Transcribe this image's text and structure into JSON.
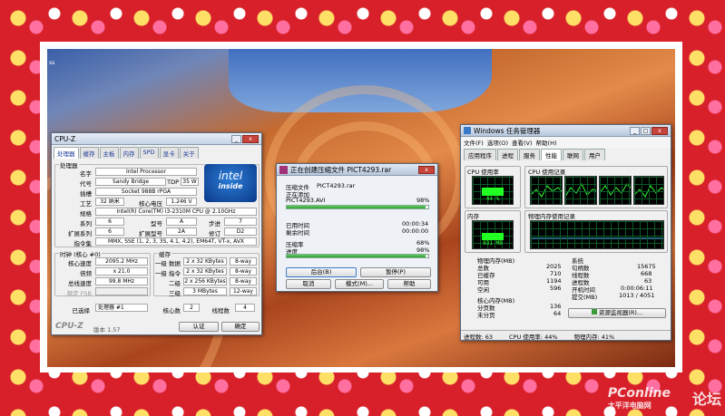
{
  "desktop": {
    "corner_text": "ss"
  },
  "cpuz": {
    "title": "CPU-Z",
    "tabs": [
      "处理器",
      "缓存",
      "主板",
      "内存",
      "SPD",
      "显卡",
      "关于"
    ],
    "group_processor": "处理器",
    "name_label": "名字",
    "name_value": "Intel Processor",
    "codename_label": "代号",
    "codename_value": "Sandy Bridge",
    "tdp_label": "TDP",
    "tdp_value": "35 W",
    "socket_label": "插槽",
    "socket_value": "Socket 988B rPGA",
    "tech_label": "工艺",
    "tech_value": "32 纳米",
    "voltage_label": "核心电压",
    "voltage_value": "1.246 V",
    "spec_label": "规格",
    "spec_value": "Intel(R) Core(TM) i3-2310M CPU @ 2.10GHz",
    "family_label": "系列",
    "family_value": "6",
    "model_label": "型号",
    "model_value": "A",
    "stepping_label": "步进",
    "stepping_value": "7",
    "extfamily_label": "扩展系列",
    "extfamily_value": "6",
    "extmodel_label": "扩展型号",
    "extmodel_value": "2A",
    "revision_label": "修订",
    "revision_value": "D2",
    "instr_label": "指令集",
    "instr_value": "MMX, SSE (1, 2, 3, 3S, 4.1, 4.2), EM64T, VT-x, AVX",
    "group_clocks": "时钟 (核心 #0)",
    "core_speed_label": "核心速度",
    "core_speed_value": "2095.2 MHz",
    "multiplier_label": "倍频",
    "multiplier_value": "x 21.0",
    "bus_label": "总线速度",
    "bus_value": "99.8 MHz",
    "fsb_label": "额定 FSB",
    "fsb_value": "",
    "group_cache": "缓存",
    "l1d_label": "一级 数据",
    "l1d_value": "2 x 32 KBytes",
    "l1d_way": "8-way",
    "l1i_label": "一级 指令",
    "l1i_value": "2 x 32 KBytes",
    "l1i_way": "8-way",
    "l2_label": "二级",
    "l2_value": "2 x 256 KBytes",
    "l2_way": "8-way",
    "l3_label": "三级",
    "l3_value": "3 MBytes",
    "l3_way": "12-way",
    "selected_label": "已选择",
    "selected_value": "处理器 #1",
    "cores_label": "核心数",
    "cores_value": "2",
    "threads_label": "线程数",
    "threads_value": "4",
    "brand": "CPU-Z",
    "version": "版本 1.57",
    "validate_button": "认证",
    "ok_button": "确定",
    "intel_text1": "intel",
    "intel_text2": "inside"
  },
  "rar": {
    "title": "正在创建压缩文件 PICT4293.rar",
    "line1_label": "压缩文件",
    "line1_value": "PICT4293.rar",
    "line2": "正在添加",
    "file_name": "PICT4293.AVI",
    "file_pct": "98%",
    "file_progress": 0.98,
    "elapsed_label": "已用时间",
    "elapsed_value": "00:00:34",
    "remaining_label": "剩余时间",
    "remaining_value": "00:00:00",
    "ratio_label": "压缩率",
    "ratio_value": "68%",
    "progress_label": "进度",
    "progress_value": "98%",
    "total_progress": 0.98,
    "btn_background": "后台(B)",
    "btn_pause": "暂停(P)",
    "btn_cancel": "取消",
    "btn_mode": "模式(M)...",
    "btn_help": "帮助"
  },
  "taskmgr": {
    "title": "Windows 任务管理器",
    "menu": [
      "文件(F)",
      "选项(O)",
      "查看(V)",
      "帮助(H)"
    ],
    "tabs": [
      "应用程序",
      "进程",
      "服务",
      "性能",
      "联网",
      "用户"
    ],
    "cpu_usage_label": "CPU 使用率",
    "cpu_usage_value": "44 %",
    "cpu_history_label": "CPU 使用记录",
    "mem_label": "内存",
    "mem_value": "831 MB",
    "mem_history_label": "物理内存使用记录",
    "phys_label": "物理内存(MB)",
    "total_label": "总数",
    "total_value": "2025",
    "cached_label": "已缓存",
    "cached_value": "710",
    "available_label": "可用",
    "available_value": "1194",
    "free_label": "空闲",
    "free_value": "596",
    "kernel_label": "核心内存(MB)",
    "paged_label": "分页数",
    "paged_value": "136",
    "nonpaged_label": "未分页",
    "nonpaged_value": "64",
    "system_label": "系统",
    "handles_label": "句柄数",
    "handles_value": "15675",
    "threads_label": "线程数",
    "threads_value": "668",
    "processes_label": "进程数",
    "processes_value": "63",
    "uptime_label": "开机时间",
    "uptime_value": "0:00:06:11",
    "commit_label": "提交(MB)",
    "commit_value": "1013 / 4051",
    "resmon_button": "资源监视器(R)...",
    "status_processes": "进程数: 63",
    "status_cpu": "CPU 使用率: 44%",
    "status_mem": "物理内存: 41%"
  },
  "watermark": {
    "site": "PConline",
    "sub": "太平洋电脑网",
    "forum": "论坛"
  }
}
